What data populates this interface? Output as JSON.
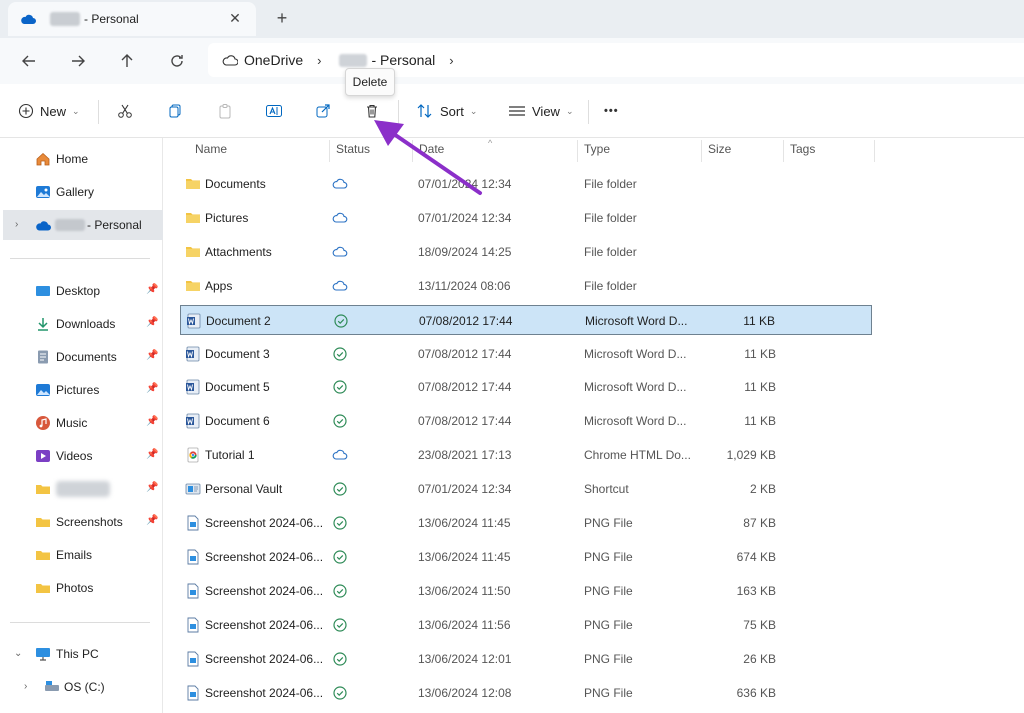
{
  "tab": {
    "title": "- Personal",
    "close_icon": "close-icon",
    "new_tab": "+"
  },
  "address": {
    "root": "OneDrive",
    "current": "- Personal"
  },
  "tooltip": {
    "text": "Delete"
  },
  "commands": {
    "new_label": "New",
    "sort_label": "Sort",
    "view_label": "View",
    "more": "•••"
  },
  "columns": {
    "name": "Name",
    "status": "Status",
    "date": "Date",
    "type": "Type",
    "size": "Size",
    "tags": "Tags"
  },
  "sidebar": {
    "home": "Home",
    "gallery": "Gallery",
    "onedrive": "- Personal",
    "quick": [
      {
        "label": "Desktop",
        "icon": "desktop-icon",
        "pinned": true
      },
      {
        "label": "Downloads",
        "icon": "download-icon",
        "pinned": true
      },
      {
        "label": "Documents",
        "icon": "documents-icon",
        "pinned": true
      },
      {
        "label": "Pictures",
        "icon": "pictures-icon",
        "pinned": true
      },
      {
        "label": "Music",
        "icon": "music-icon",
        "pinned": true
      },
      {
        "label": "Videos",
        "icon": "videos-icon",
        "pinned": true
      },
      {
        "label": "",
        "icon": "folder-icon",
        "pinned": true
      },
      {
        "label": "Screenshots",
        "icon": "folder-icon",
        "pinned": true
      },
      {
        "label": "Emails",
        "icon": "folder-icon",
        "pinned": false
      },
      {
        "label": "Photos",
        "icon": "folder-icon",
        "pinned": false
      }
    ],
    "this_pc": "This PC",
    "os_drive": "OS (C:)"
  },
  "files": [
    {
      "name": "Documents",
      "kind": "folder",
      "status": "cloud",
      "date": "07/01/2024 12:34",
      "type": "File folder",
      "size": ""
    },
    {
      "name": "Pictures",
      "kind": "folder",
      "status": "cloud",
      "date": "07/01/2024 12:34",
      "type": "File folder",
      "size": ""
    },
    {
      "name": "Attachments",
      "kind": "folder",
      "status": "cloud",
      "date": "18/09/2024 14:25",
      "type": "File folder",
      "size": ""
    },
    {
      "name": "Apps",
      "kind": "folder",
      "status": "cloud",
      "date": "13/11/2024 08:06",
      "type": "File folder",
      "size": ""
    },
    {
      "name": "Document 2",
      "kind": "word",
      "status": "synced",
      "date": "07/08/2012 17:44",
      "type": "Microsoft Word D...",
      "size": "11 KB",
      "selected": true
    },
    {
      "name": "Document 3",
      "kind": "word",
      "status": "synced",
      "date": "07/08/2012 17:44",
      "type": "Microsoft Word D...",
      "size": "11 KB"
    },
    {
      "name": "Document 5",
      "kind": "word",
      "status": "synced",
      "date": "07/08/2012 17:44",
      "type": "Microsoft Word D...",
      "size": "11 KB"
    },
    {
      "name": "Document 6",
      "kind": "word",
      "status": "synced",
      "date": "07/08/2012 17:44",
      "type": "Microsoft Word D...",
      "size": "11 KB"
    },
    {
      "name": "Tutorial 1",
      "kind": "chrome",
      "status": "cloud",
      "date": "23/08/2021 17:13",
      "type": "Chrome HTML Do...",
      "size": "1,029 KB"
    },
    {
      "name": "Personal Vault",
      "kind": "shortcut",
      "status": "synced",
      "date": "07/01/2024 12:34",
      "type": "Shortcut",
      "size": "2 KB"
    },
    {
      "name": "Screenshot 2024-06...",
      "kind": "png",
      "status": "synced",
      "date": "13/06/2024 11:45",
      "type": "PNG File",
      "size": "87 KB"
    },
    {
      "name": "Screenshot 2024-06...",
      "kind": "png",
      "status": "synced",
      "date": "13/06/2024 11:45",
      "type": "PNG File",
      "size": "674 KB"
    },
    {
      "name": "Screenshot 2024-06...",
      "kind": "png",
      "status": "synced",
      "date": "13/06/2024 11:50",
      "type": "PNG File",
      "size": "163 KB"
    },
    {
      "name": "Screenshot 2024-06...",
      "kind": "png",
      "status": "synced",
      "date": "13/06/2024 11:56",
      "type": "PNG File",
      "size": "75 KB"
    },
    {
      "name": "Screenshot 2024-06...",
      "kind": "png",
      "status": "synced",
      "date": "13/06/2024 12:01",
      "type": "PNG File",
      "size": "26 KB"
    },
    {
      "name": "Screenshot 2024-06...",
      "kind": "png",
      "status": "synced",
      "date": "13/06/2024 12:08",
      "type": "PNG File",
      "size": "636 KB"
    }
  ],
  "colors": {
    "accent": "#0067c0",
    "selected_row": "#cce4f7",
    "annotation": "#8b2fc9",
    "synced": "#2e8b57"
  }
}
